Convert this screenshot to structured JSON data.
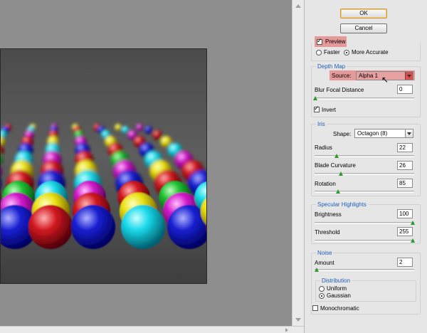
{
  "buttons": {
    "ok": "OK",
    "cancel": "Cancel"
  },
  "preview": {
    "label": "Preview",
    "checked": true
  },
  "quality": {
    "faster": "Faster",
    "more_accurate": "More Accurate",
    "selected": "more_accurate"
  },
  "depth_map": {
    "title": "Depth Map",
    "source_label": "Source:",
    "source_value": "Alpha 1",
    "blur_focal_label": "Blur Focal Distance",
    "blur_focal_value": "0",
    "invert_label": "Invert",
    "invert_checked": true
  },
  "iris": {
    "title": "Iris",
    "shape_label": "Shape:",
    "shape_value": "Octagon (8)",
    "radius_label": "Radius",
    "radius_value": "22",
    "blade_label": "Blade Curvature",
    "blade_value": "26",
    "rotation_label": "Rotation",
    "rotation_value": "85"
  },
  "specular": {
    "title": "Specular Highlights",
    "brightness_label": "Brightness",
    "brightness_value": "100",
    "threshold_label": "Threshold",
    "threshold_value": "255"
  },
  "noise": {
    "title": "Noise",
    "amount_label": "Amount",
    "amount_value": "2",
    "distribution_title": "Distribution",
    "uniform": "Uniform",
    "gaussian": "Gaussian",
    "selected": "gaussian",
    "monochromatic_label": "Monochromatic",
    "monochromatic_checked": false
  },
  "colors": {
    "accent_text": "#1f5fb8",
    "highlight": "#e65a5a",
    "slider_thumb": "#2b9b2b"
  }
}
